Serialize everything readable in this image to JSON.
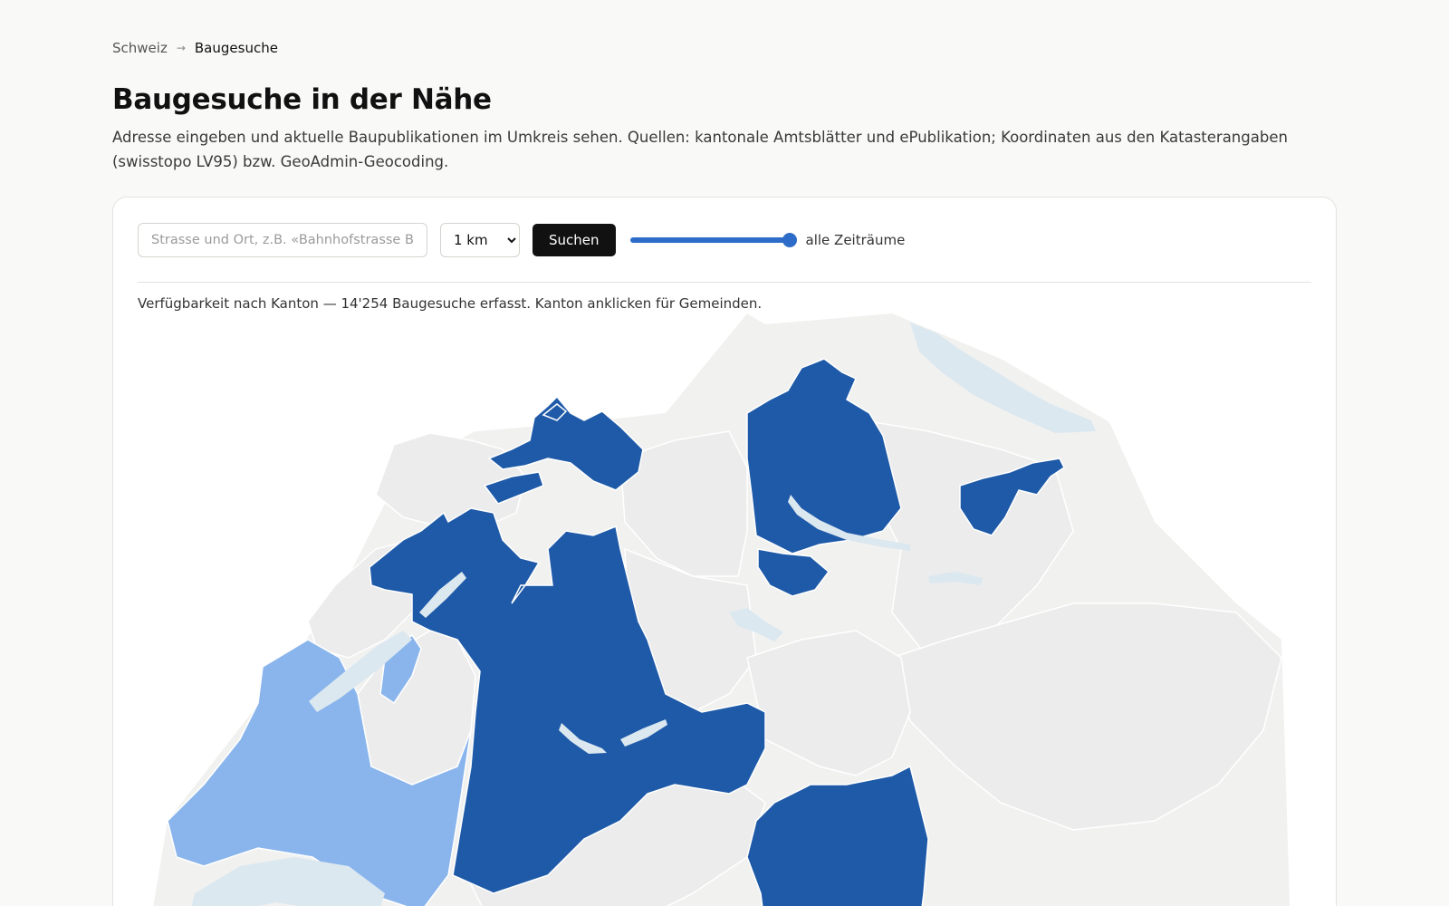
{
  "breadcrumb": {
    "parent": "Schweiz",
    "separator": "→",
    "current": "Baugesuche"
  },
  "page": {
    "title": "Baugesuche in der Nähe",
    "intro": "Adresse eingeben und aktuelle Baupublikationen im Umkreis sehen. Quellen: kantonale Amtsblätter und ePublikation; Koordinaten aus den Katasterangaben (swisstopo LV95) bzw. GeoAdmin-Geocoding."
  },
  "search": {
    "placeholder": "Strasse und Ort, z.B. «Bahnhofstrasse Bu",
    "value": "",
    "radius_selected": "1 km",
    "button_label": "Suchen",
    "timerange_label": "alle Zeiträume",
    "timerange_level": 1.0
  },
  "availability": {
    "text": "Verfügbarkeit nach Kanton — 14'254 Baugesuche erfasst. Kanton anklicken für Gemeinden."
  },
  "map": {
    "colors": {
      "available": "#1e5aa8",
      "partial": "#8ab5ec",
      "unavailable": "#ececec",
      "lake": "#dde9f0",
      "border": "#ffffff",
      "neighbor": "#f0f0f0"
    },
    "cantons": [
      {
        "id": "BS",
        "status": "available"
      },
      {
        "id": "BL",
        "status": "available"
      },
      {
        "id": "SO",
        "status": "available"
      },
      {
        "id": "BE",
        "status": "available"
      },
      {
        "id": "ZH",
        "status": "available"
      },
      {
        "id": "ZG",
        "status": "available"
      },
      {
        "id": "AR",
        "status": "available"
      },
      {
        "id": "TI",
        "status": "available"
      },
      {
        "id": "VD",
        "status": "partial"
      },
      {
        "id": "FR",
        "status": "partial"
      },
      {
        "id": "JU",
        "status": "unavailable"
      },
      {
        "id": "NE",
        "status": "unavailable"
      },
      {
        "id": "AG",
        "status": "unavailable"
      },
      {
        "id": "LU",
        "status": "unavailable"
      },
      {
        "id": "SH",
        "status": "unavailable"
      },
      {
        "id": "TG",
        "status": "unavailable"
      },
      {
        "id": "SG",
        "status": "unavailable"
      },
      {
        "id": "GR",
        "status": "unavailable"
      },
      {
        "id": "VS",
        "status": "unavailable"
      },
      {
        "id": "UR",
        "status": "unavailable"
      },
      {
        "id": "SZ",
        "status": "unavailable"
      },
      {
        "id": "GL",
        "status": "unavailable"
      },
      {
        "id": "OW",
        "status": "unavailable"
      },
      {
        "id": "NW",
        "status": "unavailable"
      },
      {
        "id": "AI",
        "status": "unavailable"
      },
      {
        "id": "GE",
        "status": "unavailable"
      }
    ]
  }
}
